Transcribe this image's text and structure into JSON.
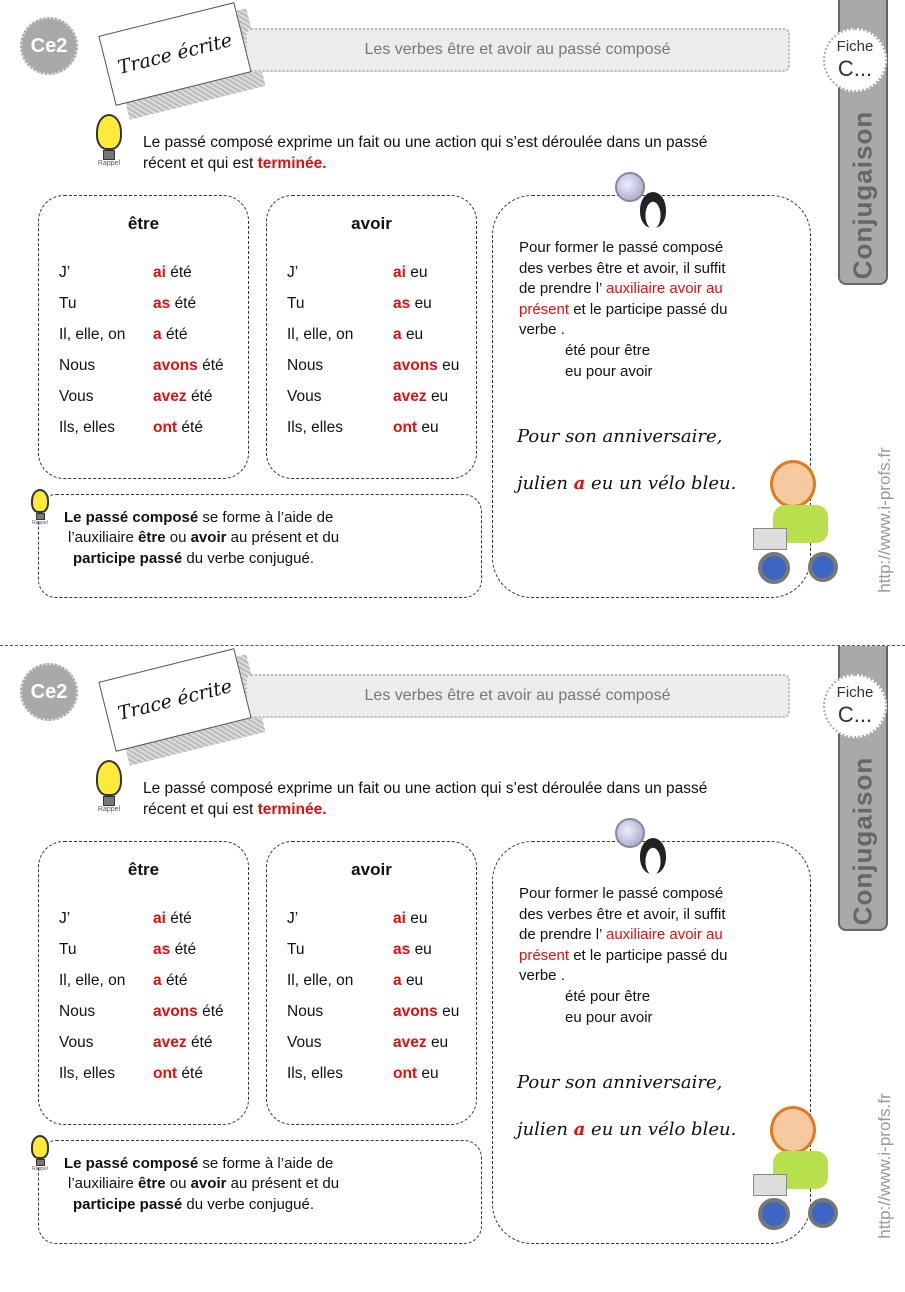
{
  "header": {
    "level": "Ce2",
    "trace": "Trace écrite",
    "title": "Les verbes être et avoir  au passé composé",
    "fiche_label": "Fiche",
    "fiche_code": "C...",
    "subject": "Conjugaison",
    "url": "http://www.i-profs.fr"
  },
  "intro": {
    "rappel": "Rappel",
    "line1": "Le passé composé  exprime un fait ou une action qui s’est déroulée dans un passé",
    "line2": "récent  et qui est ",
    "emphasis": "terminée."
  },
  "etre": {
    "title": "être",
    "rows": [
      {
        "pronoun": "J’",
        "aux": "ai",
        "participle": "été"
      },
      {
        "pronoun": "Tu",
        "aux": "as",
        "participle": "été"
      },
      {
        "pronoun": "Il, elle, on",
        "aux": "a",
        "participle": "été"
      },
      {
        "pronoun": "Nous",
        "aux": "avons",
        "participle": "été"
      },
      {
        "pronoun": "Vous",
        "aux": "avez",
        "participle": "été"
      },
      {
        "pronoun": "Ils, elles",
        "aux": "ont",
        "participle": "été"
      }
    ]
  },
  "avoir": {
    "title": "avoir",
    "rows": [
      {
        "pronoun": "J’",
        "aux": "ai",
        "participle": "eu"
      },
      {
        "pronoun": "Tu",
        "aux": "as",
        "participle": "eu"
      },
      {
        "pronoun": "Il, elle, on",
        "aux": "a",
        "participle": "eu"
      },
      {
        "pronoun": "Nous",
        "aux": "avons",
        "participle": "eu"
      },
      {
        "pronoun": "Vous",
        "aux": "avez",
        "participle": "eu"
      },
      {
        "pronoun": "Ils, elles",
        "aux": "ont",
        "participle": "eu"
      }
    ]
  },
  "rule": {
    "l1": "Pour former le passé composé",
    "l2": "des verbes être et avoir, il suffit",
    "l3a": "de prendre l’ ",
    "l3b": "auxiliaire avoir au",
    "l4a": "présent",
    "l4b": "  et le participe passé du",
    "l5": "verbe .",
    "l6": "été pour être",
    "l7": "eu pour avoir",
    "ex1": "Pour son anniversaire,",
    "ex2a": "julien ",
    "ex2b": "a",
    "ex2c": " eu un vélo bleu."
  },
  "summary": {
    "b1": "Le passé composé",
    "t1": " se forme à l’aide de",
    "t2a": "l’auxiliaire ",
    "b2": "être",
    "t2b": " ou ",
    "b3": "avoir",
    "t2c": " au présent et du",
    "b4": "participe  passé",
    "t3": " du verbe conjugué."
  },
  "colors": {
    "accent": "#e01010",
    "gray": "#a9a9a9"
  }
}
